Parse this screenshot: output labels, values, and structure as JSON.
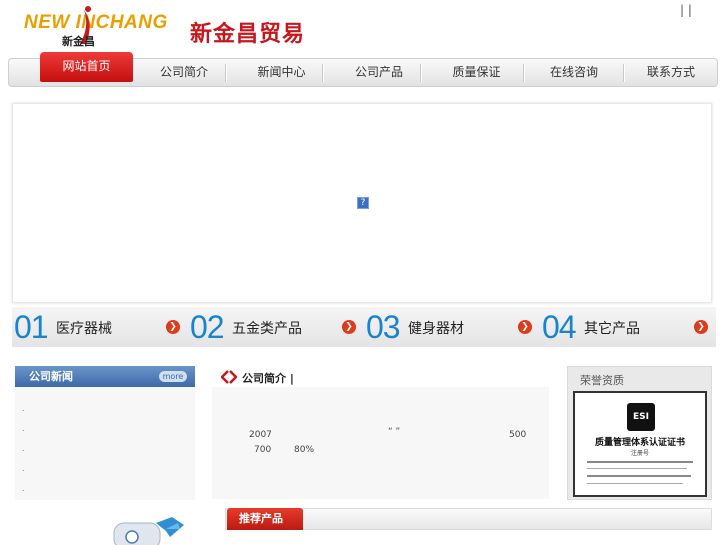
{
  "header": {
    "logo_en": "NEW INCHANG",
    "logo_cn": "新金昌",
    "site_name": "新金昌贸易",
    "top_links": "|   |"
  },
  "nav": {
    "items": [
      "网站首页",
      "公司简介",
      "新闻中心",
      "公司产品",
      "质量保证",
      "在线咨询",
      "联系方式"
    ]
  },
  "categories": [
    {
      "num": "01",
      "label": "医疗器械"
    },
    {
      "num": "02",
      "label": "五金类产品"
    },
    {
      "num": "03",
      "label": "健身器材"
    },
    {
      "num": "04",
      "label": "其它产品"
    }
  ],
  "news": {
    "title": "公司新闻",
    "more": "more",
    "items": [
      ".",
      ".",
      ".",
      ".",
      "."
    ]
  },
  "about": {
    "title": "公司简介 |",
    "year": "2007",
    "quote": "“    ”",
    "num1": "500",
    "num2": "700",
    "percent": "80%"
  },
  "honor": {
    "title": "荣誉资质",
    "cert_title": "质量管理体系认证证书",
    "cert_sub": "注册号"
  },
  "recommend": {
    "title": "推荐产品"
  },
  "colors": {
    "brand_red": "#c8161d",
    "accent_blue": "#1b83c9",
    "logo_orange": "#e8a000"
  }
}
